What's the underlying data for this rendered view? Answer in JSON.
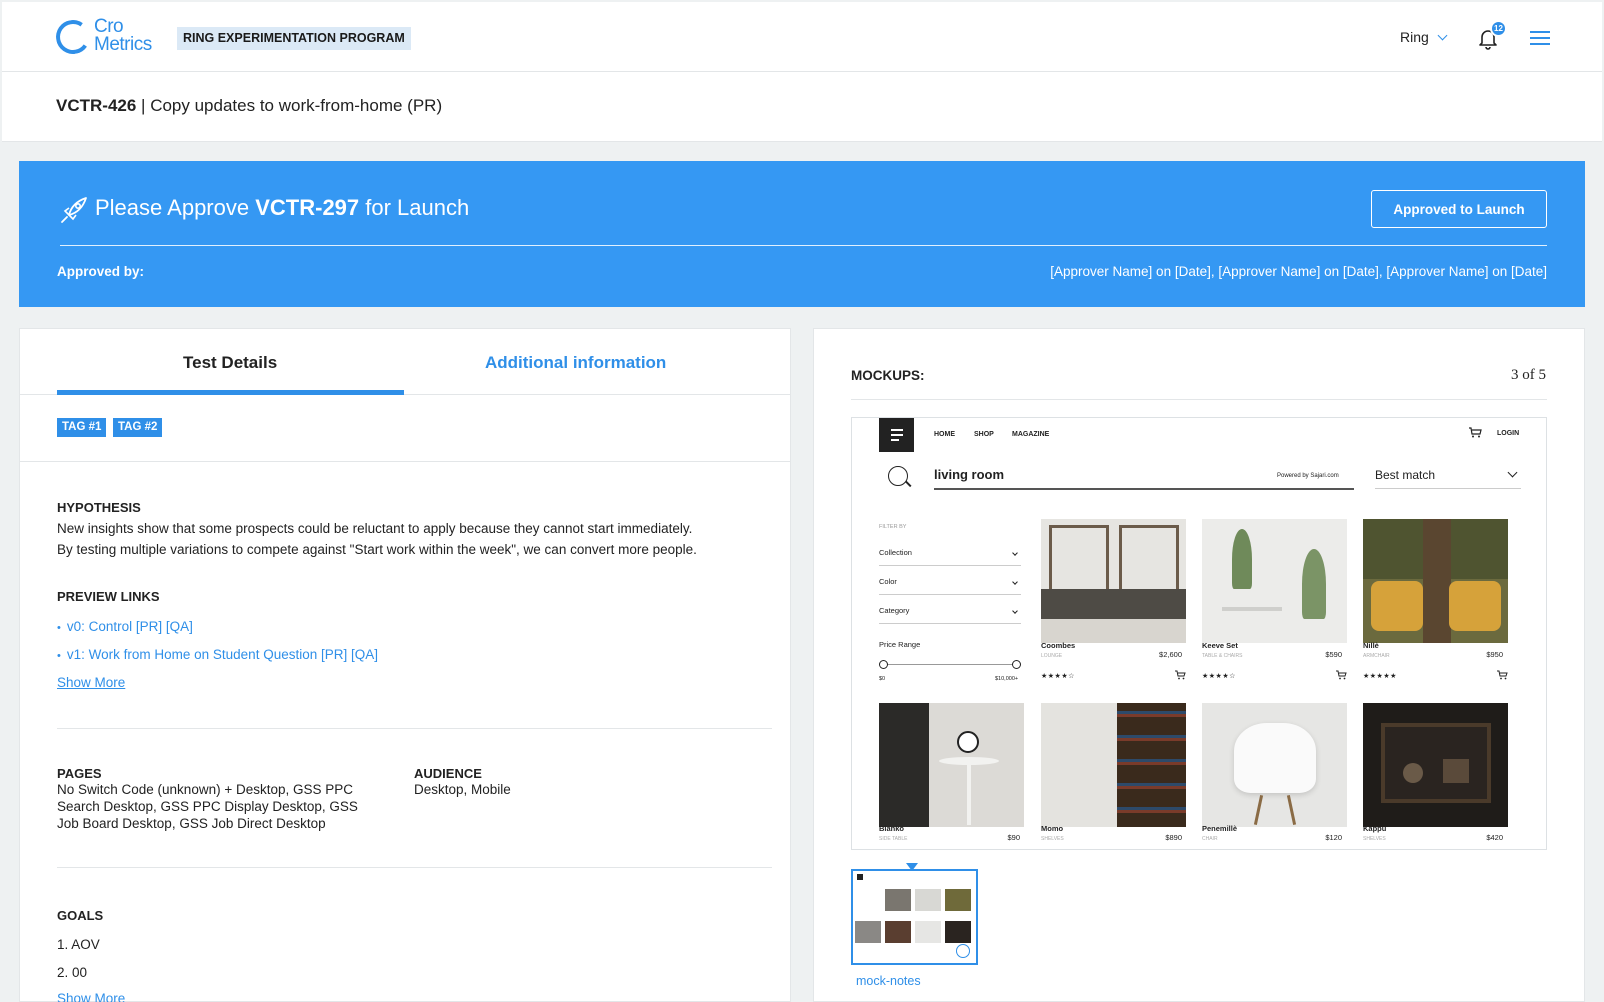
{
  "header": {
    "logo_line1": "Cro",
    "logo_line2": "Metrics",
    "program": "RING EXPERIMENTATION PROGRAM",
    "client": "Ring",
    "notification_count": "12"
  },
  "title": {
    "id": "VCTR-426",
    "separator": " | ",
    "name": "Copy updates to work-from-home (PR)"
  },
  "banner": {
    "prefix": "Please Approve ",
    "id": "VCTR-297",
    "suffix": " for Launch",
    "button": "Approved to Launch",
    "approved_label": "Approved by:",
    "approved_names": "[Approver Name] on [Date], [Approver Name] on [Date], [Approver Name] on [Date]"
  },
  "tabs": {
    "details": "Test Details",
    "additional": "Additional information"
  },
  "tags": [
    "TAG #1",
    "TAG #2"
  ],
  "hypothesis": {
    "heading": "HYPOTHESIS",
    "line1": "New insights show that some prospects could be reluctant to apply because they cannot start immediately.",
    "line2": "By testing multiple variations to compete against \"Start work within the week\", we can convert more people."
  },
  "preview_links": {
    "heading": "PREVIEW LINKS",
    "bullet": "•",
    "items": [
      "v0: Control [PR] [QA]",
      "v1: Work from Home on Student Question [PR] [QA]"
    ],
    "show_more": "Show More"
  },
  "pages": {
    "heading": "PAGES",
    "lines": [
      "No Switch Code (unknown) + Desktop, GSS PPC",
      "Search Desktop, GSS PPC Display Desktop, GSS",
      "Job Board Desktop, GSS Job Direct Desktop"
    ]
  },
  "audience": {
    "heading": "AUDIENCE",
    "value": "Desktop, Mobile"
  },
  "goals": {
    "heading": "GOALS",
    "items": [
      "1. AOV",
      "2. 00"
    ],
    "show_more": "Show More"
  },
  "mockups": {
    "heading": "MOCKUPS:",
    "count": "3 of 5",
    "thumb_label": "mock-notes",
    "screen": {
      "nav": [
        "HOME",
        "SHOP",
        "MAGAZINE"
      ],
      "login": "LOGIN",
      "query": "living room",
      "powered": "Powered by Sajari.com",
      "sort": "Best match",
      "filter_heading": "FILTER BY",
      "filters": [
        "Collection",
        "Color",
        "Category"
      ],
      "price_heading": "Price Range",
      "price_min": "$0",
      "price_max": "$10,000+",
      "products": [
        {
          "name": "Coombes",
          "sub": "LOUNGE",
          "price": "$2,600",
          "stars": "★★★★☆"
        },
        {
          "name": "Keeve Set",
          "sub": "TABLE & CHAIRS",
          "price": "$590",
          "stars": "★★★★☆"
        },
        {
          "name": "Nillè",
          "sub": "ARMCHAIR",
          "price": "$950",
          "stars": "★★★★★"
        },
        {
          "name": "Blanko",
          "sub": "SIDE TABLE",
          "price": "$90"
        },
        {
          "name": "Momo",
          "sub": "SHELVES",
          "price": "$890"
        },
        {
          "name": "Penemillè",
          "sub": "CHAIR",
          "price": "$120"
        },
        {
          "name": "Kappu",
          "sub": "SHELVES",
          "price": "$420"
        }
      ]
    }
  },
  "colors": {
    "accent": "#2f8fe8",
    "banner": "#3598f3"
  }
}
